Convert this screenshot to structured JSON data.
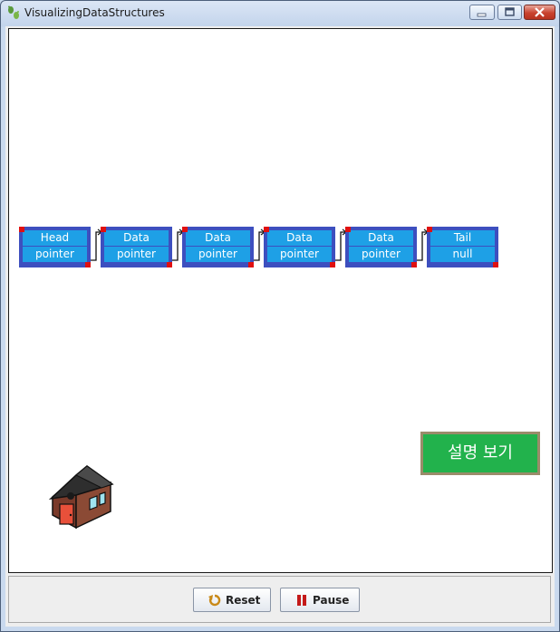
{
  "window": {
    "title": "VisualizingDataStructures"
  },
  "list": {
    "nodes": [
      {
        "top": "Head",
        "bottom": "pointer"
      },
      {
        "top": "Data",
        "bottom": "pointer"
      },
      {
        "top": "Data",
        "bottom": "pointer"
      },
      {
        "top": "Data",
        "bottom": "pointer"
      },
      {
        "top": "Data",
        "bottom": "pointer"
      },
      {
        "top": "Tail",
        "bottom": "null"
      }
    ]
  },
  "explain_button": {
    "label": "설명 보기"
  },
  "controls": {
    "reset_label": "Reset",
    "pause_label": "Pause"
  },
  "colors": {
    "node_border": "#3d4fbf",
    "node_fill": "#1ea0e6",
    "corner": "#e01010",
    "explain_bg": "#22b24c"
  }
}
